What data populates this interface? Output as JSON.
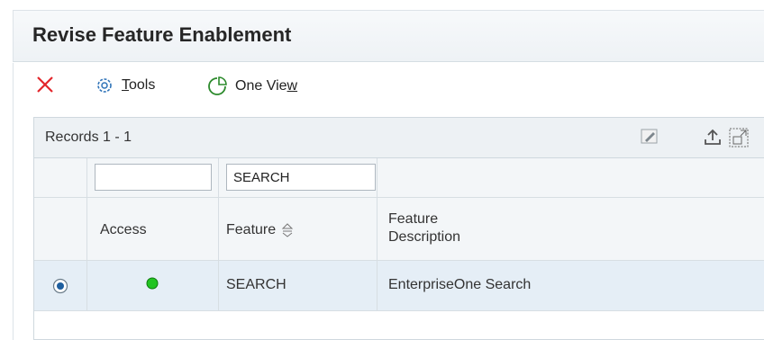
{
  "header": {
    "title": "Revise Feature Enablement"
  },
  "toolbar": {
    "tools_label": "Tools",
    "one_view_label": "One View"
  },
  "grid": {
    "records_label": "Records 1 - 1",
    "filters": {
      "access": "",
      "feature": "SEARCH"
    },
    "columns": {
      "access": "Access",
      "feature": "Feature",
      "description_line1": "Feature",
      "description_line2": "Description"
    },
    "rows": [
      {
        "selected": true,
        "access_status": "enabled",
        "access_color": "#22c422",
        "feature": "SEARCH",
        "description": "EnterpriseOne Search"
      }
    ]
  },
  "colors": {
    "accent_red": "#e3262b",
    "icon_blue": "#2f73b8",
    "icon_green": "#2c8a2c",
    "row_highlight": "#e5eef6"
  }
}
